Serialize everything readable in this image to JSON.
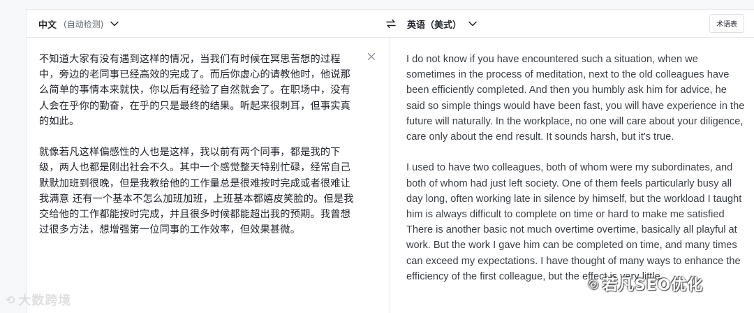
{
  "header": {
    "source_lang": "中文",
    "source_detect": "(自动检测)",
    "target_lang": "英语（美式）",
    "glossary_button": "术语表"
  },
  "source": {
    "paragraphs": [
      "不知道大家有没有遇到这样的情况，当我们有时候在冥思苦想的过程中，旁边的老同事已经高效的完成了。而后你虚心的请教他时，他说那么简单的事情本来就快，你以后有经验了自然就会了。在职场中，没有人会在乎你的勤奋，在乎的只是最终的结果。听起来很刺耳，但事实真的如此。",
      "就像若凡这样偏感性的人也是这样，我以前有两个同事，都是我的下级，两人也都是刚出社会不久。其中一个感觉整天特别忙碌，经常自己默默加班到很晚，但是我教给他的工作量总是很难按时完成或者很难让我满意 还有一个基本不怎么加班加班，上班基本都嬉皮笑脸的。但是我交给他的工作都能按时完成，并且很多时候都能超出我的预期。我曾想过很多方法，想增强第一位同事的工作效率，但效果甚微。"
    ]
  },
  "target": {
    "paragraphs": [
      "I do not know if you have encountered such a situation, when we sometimes in the process of meditation, next to the old colleagues have been efficiently completed. And then you humbly ask him for advice, he said so simple things would have been fast, you will have experience in the future will naturally. In the workplace, no one will care about your diligence, care only about the end result. It sounds harsh, but it's true.",
      "I used to have two colleagues, both of whom were my subordinates, and both of whom had just left society. One of them feels particularly busy all day long, often working late in silence by himself, but the workload I taught him is always difficult to complete on time or hard to make me satisfied There is another basic not much overtime overtime, basically all playful at work. But the work I gave him can be completed on time, and many times can exceed my expectations. I have thought of many ways to enhance the efficiency of the first colleague, but the effect is very little."
    ]
  },
  "watermarks": {
    "left": "大数跨境",
    "right": "若凡SEO优化"
  },
  "icons": {
    "dropdown": "chevron-down-icon",
    "swap": "swap-arrows-icon",
    "clear": "close-icon"
  },
  "colors": {
    "text": "#1f2329",
    "muted": "#646a73",
    "border": "#e6e8eb",
    "background": "#f7f8fa"
  }
}
